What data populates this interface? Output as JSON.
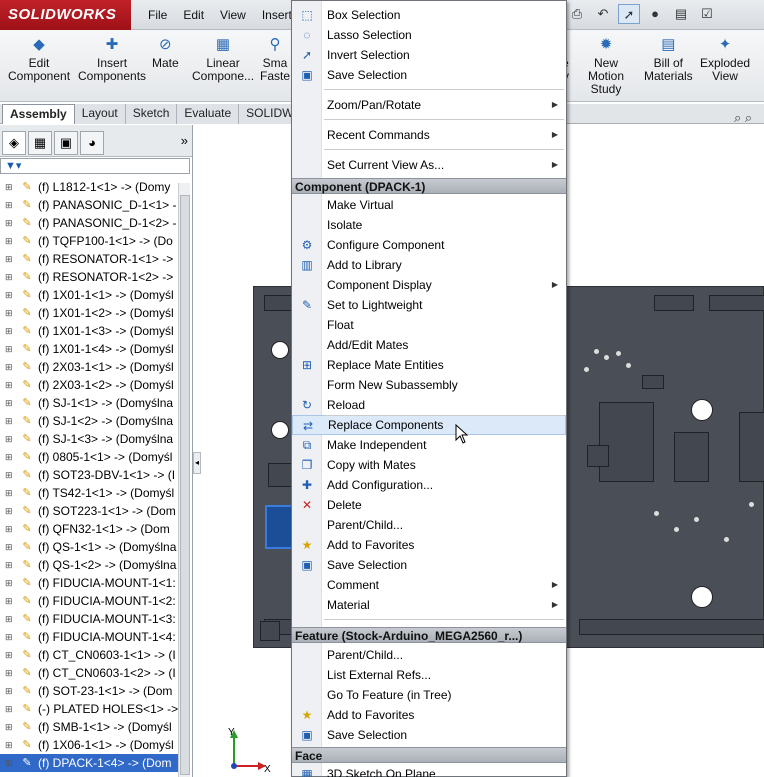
{
  "app": {
    "logo": "SOLIDWORKS"
  },
  "menubar": [
    "File",
    "Edit",
    "View",
    "Insert"
  ],
  "ribbon": {
    "buttons": [
      {
        "label": "Edit\nComponent",
        "icon": "edit-component-icon"
      },
      {
        "label": "Insert\nComponents",
        "icon": "insert-components-icon"
      },
      {
        "label": "Mate",
        "icon": "mate-icon"
      },
      {
        "label": "Linear\nCompone...",
        "icon": "linear-pattern-icon"
      },
      {
        "label": "Sma\nFaste",
        "icon": "smart-fasteners-icon"
      },
      {
        "label": "nce\netry",
        "icon": "reference-geometry-icon"
      },
      {
        "label": "New\nMotion\nStudy",
        "icon": "motion-study-icon"
      },
      {
        "label": "Bill of\nMaterials",
        "icon": "bom-icon"
      },
      {
        "label": "Exploded\nView",
        "icon": "exploded-view-icon"
      }
    ],
    "tabs": [
      "Assembly",
      "Layout",
      "Sketch",
      "Evaluate",
      "SOLIDW"
    ]
  },
  "tree": {
    "items": [
      "(f) L1812-1<1> -> (Domy",
      "(f) PANASONIC_D-1<1> -",
      "(f) PANASONIC_D-1<2> -",
      "(f) TQFP100-1<1> -> (Do",
      "(f) RESONATOR-1<1> ->",
      "(f) RESONATOR-1<2> ->",
      "(f) 1X01-1<1> -> (Domyśl",
      "(f) 1X01-1<2> -> (Domyśl",
      "(f) 1X01-1<3> -> (Domyśl",
      "(f) 1X01-1<4> -> (Domyśl",
      "(f) 2X03-1<1> -> (Domyśl",
      "(f) 2X03-1<2> -> (Domyśl",
      "(f) SJ-1<1> -> (Domyślna",
      "(f) SJ-1<2> -> (Domyślna",
      "(f) SJ-1<3> -> (Domyślna",
      "(f) 0805-1<1> -> (Domyśl",
      "(f) SOT23-DBV-1<1> -> (I",
      "(f) TS42-1<1> -> (Domyśl",
      "(f) SOT223-1<1> -> (Dom",
      "(f) QFN32-1<1> -> (Dom",
      "(f) QS-1<1> -> (Domyślna",
      "(f) QS-1<2> -> (Domyślna",
      "(f) FIDUCIA-MOUNT-1<1:",
      "(f) FIDUCIA-MOUNT-1<2:",
      "(f) FIDUCIA-MOUNT-1<3:",
      "(f) FIDUCIA-MOUNT-1<4:",
      "(f) CT_CN0603-1<1> -> (I",
      "(f) CT_CN0603-1<2> -> (I",
      "(f) SOT-23-1<1> -> (Dom",
      "(-) PLATED HOLES<1> ->",
      "(f) SMB-1<1> -> (Domyśl",
      "(f) 1X06-1<1> -> (Domyśl",
      "(f) DPACK-1<4> -> (Dom"
    ],
    "selected_index": 32
  },
  "context_menu": {
    "top_items": [
      {
        "label": "Box Selection",
        "icon": "box-selection-icon"
      },
      {
        "label": "Lasso Selection",
        "icon": "lasso-selection-icon"
      },
      {
        "label": "Invert Selection",
        "icon": "invert-selection-icon"
      },
      {
        "label": "Save Selection",
        "icon": "save-selection-icon"
      }
    ],
    "nav_items": [
      {
        "label": "Zoom/Pan/Rotate",
        "submenu": true
      },
      {
        "label": "Recent Commands",
        "submenu": true
      },
      {
        "label": "Set Current View As...",
        "submenu": true
      }
    ],
    "component_header": "Component (DPACK-1)",
    "component_items": [
      {
        "label": "Make Virtual",
        "icon": ""
      },
      {
        "label": "Isolate",
        "icon": ""
      },
      {
        "label": "Configure Component",
        "icon": "configure-component-icon"
      },
      {
        "label": "Add to Library",
        "icon": "add-to-library-icon"
      },
      {
        "label": "Component Display",
        "icon": "",
        "submenu": true
      },
      {
        "label": "Set to Lightweight",
        "icon": "lightweight-icon"
      },
      {
        "label": "Float",
        "icon": ""
      },
      {
        "label": "Add/Edit Mates",
        "icon": ""
      },
      {
        "label": "Replace Mate Entities",
        "icon": "replace-mate-entities-icon"
      },
      {
        "label": "Form New Subassembly",
        "icon": ""
      },
      {
        "label": "Reload",
        "icon": "reload-icon"
      },
      {
        "label": "Replace Components",
        "icon": "replace-components-icon",
        "highlighted": true
      },
      {
        "label": "Make Independent",
        "icon": "make-independent-icon"
      },
      {
        "label": "Copy with Mates",
        "icon": "copy-with-mates-icon"
      },
      {
        "label": "Add Configuration...",
        "icon": "add-configuration-icon"
      },
      {
        "label": "Delete",
        "icon": "delete-icon"
      },
      {
        "label": "Parent/Child...",
        "icon": ""
      },
      {
        "label": "Add to Favorites",
        "icon": "favorites-icon"
      },
      {
        "label": "Save Selection",
        "icon": "save-selection-icon"
      },
      {
        "label": "Comment",
        "icon": "",
        "submenu": true
      },
      {
        "label": "Material",
        "icon": "",
        "submenu": true
      }
    ],
    "feature_header": "Feature (Stock-Arduino_MEGA2560_r...)",
    "feature_items": [
      {
        "label": "Parent/Child...",
        "icon": ""
      },
      {
        "label": "List External Refs...",
        "icon": ""
      },
      {
        "label": "Go To Feature (in Tree)",
        "icon": ""
      },
      {
        "label": "Add to Favorites",
        "icon": "favorites-icon"
      },
      {
        "label": "Save Selection",
        "icon": "save-selection-icon"
      }
    ],
    "face_header": "Face",
    "face_items": [
      {
        "label": "3D Sketch On Plane",
        "icon": "3d-sketch-icon"
      }
    ]
  },
  "viewport": {
    "axis_y": "Y",
    "axis_x": "X"
  }
}
